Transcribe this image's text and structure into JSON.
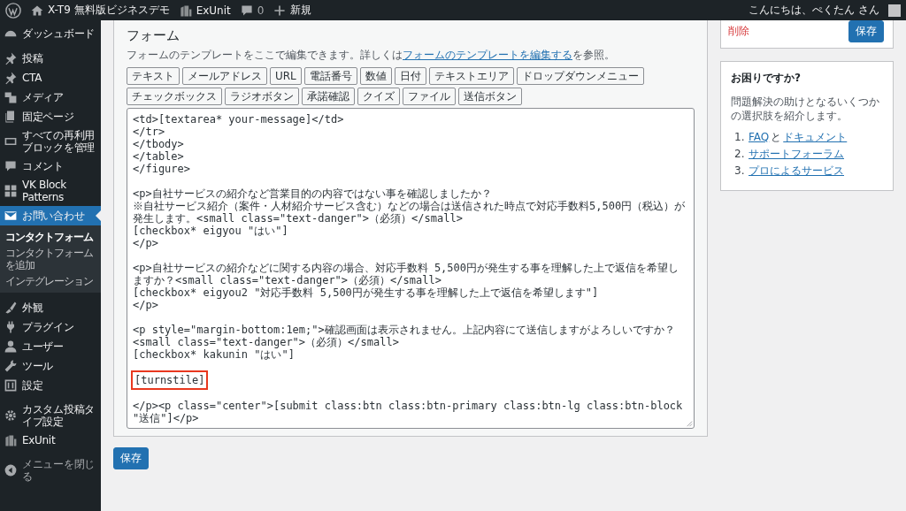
{
  "admin_bar": {
    "site_name": "X-T9 無料版ビジネスデモ",
    "plugin": "ExUnit",
    "comments": "0",
    "new": "新規",
    "greeting": "こんにちは、ぺくたん さん"
  },
  "sidebar": {
    "groups": [
      [
        {
          "label": "ダッシュボード",
          "current": false
        }
      ],
      [
        {
          "label": "投稿",
          "current": false
        },
        {
          "label": "CTA",
          "current": false
        },
        {
          "label": "メディア",
          "current": false
        },
        {
          "label": "固定ページ",
          "current": false
        },
        {
          "label": "すべての再利用ブロックを管理",
          "current": false
        },
        {
          "label": "コメント",
          "current": false
        },
        {
          "label": "VK Block Patterns",
          "current": false
        },
        {
          "label": "お問い合わせ",
          "current": true,
          "submenu": [
            {
              "label": "コンタクトフォーム",
              "selected": true
            },
            {
              "label": "コンタクトフォームを追加",
              "selected": false
            },
            {
              "label": "インテグレーション",
              "selected": false
            }
          ]
        }
      ],
      [
        {
          "label": "外観",
          "current": false
        },
        {
          "label": "プラグイン",
          "current": false
        },
        {
          "label": "ユーザー",
          "current": false
        },
        {
          "label": "ツール",
          "current": false
        },
        {
          "label": "設定",
          "current": false
        }
      ],
      [
        {
          "label": "カスタム投稿タイプ設定",
          "current": false
        },
        {
          "label": "ExUnit",
          "current": false
        }
      ]
    ],
    "collapse": "メニューを閉じる"
  },
  "form_panel": {
    "title": "フォーム",
    "description": {
      "before": "フォームのテンプレートをここで編集できます。詳しくは",
      "link": "フォームのテンプレートを編集する",
      "after": "を参照。"
    },
    "tag_buttons": [
      "テキスト",
      "メールアドレス",
      "URL",
      "電話番号",
      "数値",
      "日付",
      "テキストエリア",
      "ドロップダウンメニュー",
      "チェックボックス",
      "ラジオボタン",
      "承諾確認",
      "クイズ",
      "ファイル",
      "送信ボタン"
    ],
    "editor_blocks": [
      {
        "highlighted": false,
        "lines": [
          "<td>[textarea* your-message]</td>",
          "</tr>",
          "</tbody>",
          "</table>",
          "</figure>"
        ]
      },
      {
        "highlighted": false,
        "lines": [
          "<p>自社サービスの紹介など営業目的の内容ではない事を確認しましたか？",
          "※自社サービス紹介（案件・人材紹介サービス含む）などの場合は送信された時点で対応手数料5,500円（税込）が発生します。<small class=\"text-danger\">（必須）</small>",
          "[checkbox* eigyou \"はい\"]",
          "</p>"
        ]
      },
      {
        "highlighted": false,
        "lines": [
          "<p>自社サービスの紹介などに関する内容の場合、対応手数料 5,500円が発生する事を理解した上で返信を希望しますか？<small class=\"text-danger\">（必須）</small>",
          "[checkbox* eigyou2 \"対応手数料 5,500円が発生する事を理解した上で返信を希望します\"]",
          "</p>"
        ]
      },
      {
        "highlighted": false,
        "lines": [
          "<p style=\"margin-bottom:1em;\">確認画面は表示されません。上記内容にて送信しますがよろしいですか？<small class=\"text-danger\">（必須）</small>",
          "[checkbox* kakunin \"はい\"]"
        ]
      },
      {
        "highlighted": true,
        "lines": [
          "[turnstile]"
        ]
      },
      {
        "highlighted": false,
        "lines": [
          "</p><p class=\"center\">[submit class:btn class:btn-primary class:btn-lg class:btn-block \"送信\"]</p>"
        ]
      }
    ]
  },
  "save_button": "保存",
  "publish_box": {
    "delete": "削除",
    "save": "保存"
  },
  "help_box": {
    "title": "お困りですか?",
    "text": "問題解決の助けとなるいくつかの選択肢を紹介します。",
    "items": [
      {
        "number": "1.",
        "parts": [
          {
            "text": "FAQ",
            "link": true
          },
          {
            "text": "と",
            "link": false
          },
          {
            "text": "ドキュメント",
            "link": true
          }
        ]
      },
      {
        "number": "2.",
        "parts": [
          {
            "text": "サポートフォーラム",
            "link": true
          }
        ]
      },
      {
        "number": "3.",
        "parts": [
          {
            "text": "プロによるサービス",
            "link": true
          }
        ]
      }
    ]
  }
}
